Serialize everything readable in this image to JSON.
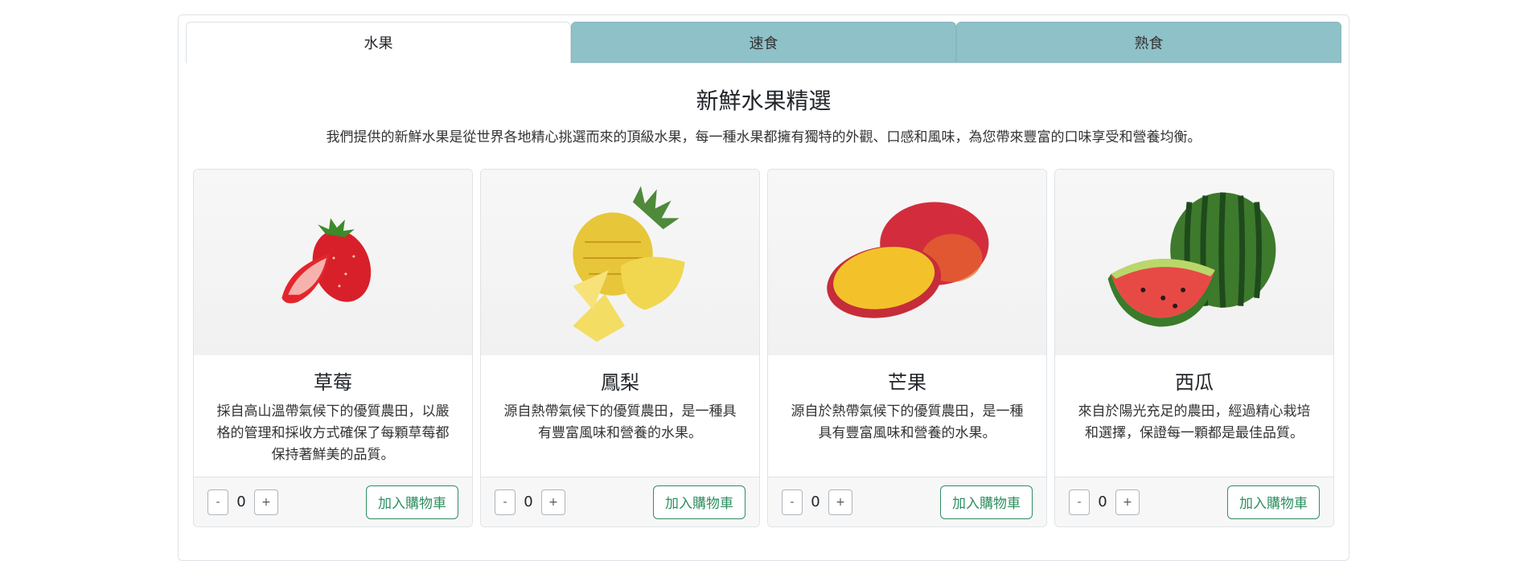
{
  "tabs": [
    {
      "label": "水果",
      "active": true
    },
    {
      "label": "速食",
      "active": false
    },
    {
      "label": "熟食",
      "active": false
    }
  ],
  "section": {
    "title": "新鮮水果精選",
    "description": "我們提供的新鮮水果是從世界各地精心挑選而來的頂級水果，每一種水果都擁有獨特的外觀、口感和風味，為您帶來豐富的口味享受和營養均衡。"
  },
  "products": [
    {
      "name": "草莓",
      "image_icon": "strawberry-image",
      "description": "採自高山溫帶氣候下的優質農田，以嚴格的管理和採收方式確保了每顆草莓都保持著鮮美的品質。",
      "quantity": "0",
      "minus_label": "-",
      "plus_label": "+",
      "add_label": "加入購物車"
    },
    {
      "name": "鳳梨",
      "image_icon": "pineapple-image",
      "description": "源自熱帶氣候下的優質農田，是一種具有豐富風味和營養的水果。",
      "quantity": "0",
      "minus_label": "-",
      "plus_label": "+",
      "add_label": "加入購物車"
    },
    {
      "name": "芒果",
      "image_icon": "mango-image",
      "description": "源自於熱帶氣候下的優質農田，是一種具有豐富風味和營養的水果。",
      "quantity": "0",
      "minus_label": "-",
      "plus_label": "+",
      "add_label": "加入購物車"
    },
    {
      "name": "西瓜",
      "image_icon": "watermelon-image",
      "description": "來自於陽光充足的農田，經過精心栽培和選擇，保證每一顆都是最佳品質。",
      "quantity": "0",
      "minus_label": "-",
      "plus_label": "+",
      "add_label": "加入購物車"
    }
  ],
  "colors": {
    "tab_inactive": "#8fc1c8",
    "accent_green": "#2f8f62"
  }
}
